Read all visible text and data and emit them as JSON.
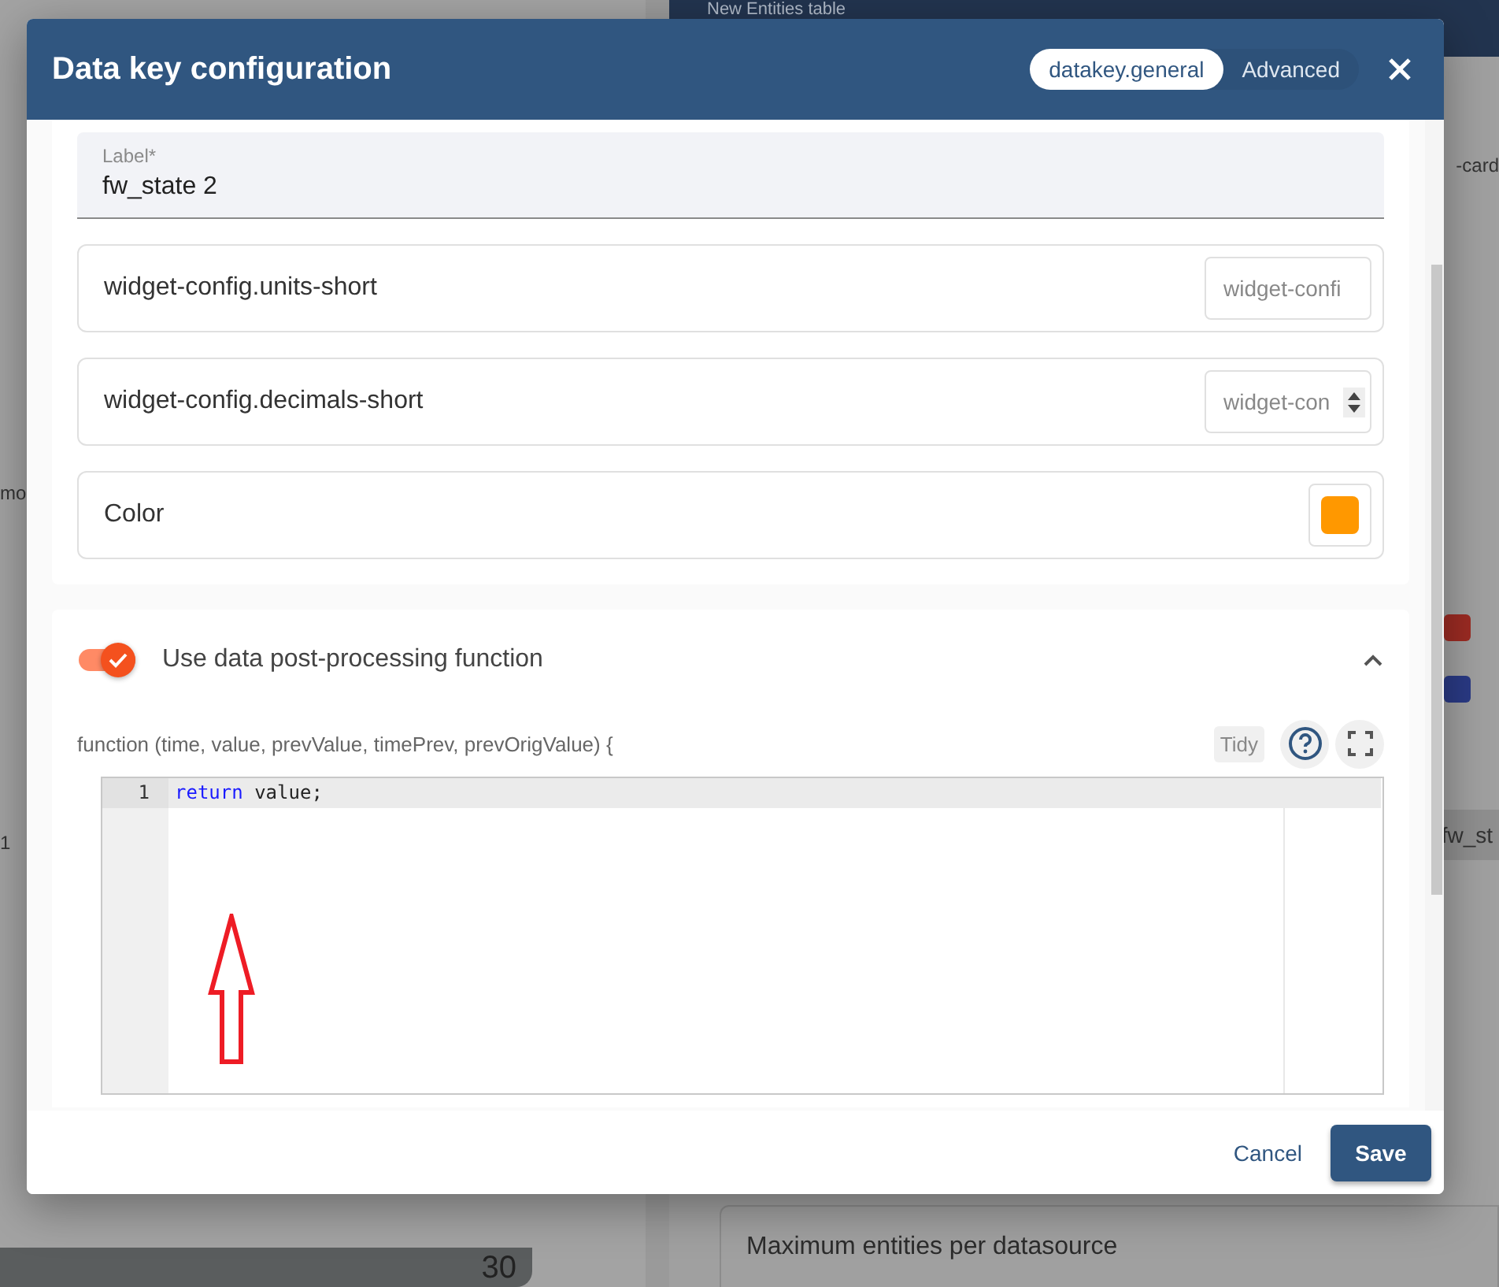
{
  "background": {
    "left_panel": {
      "texts": [
        "mo",
        "1"
      ],
      "count": "30"
    },
    "right_panel": {
      "title": "New Entities table",
      "text_1": "-card",
      "swatches": [
        {
          "color": "#9c2b23"
        },
        {
          "color": "#2a3a85"
        }
      ],
      "key_chip": "fw_st",
      "setting": "Maximum entities per datasource"
    }
  },
  "dialog": {
    "title": "Data key configuration",
    "tabs": [
      {
        "label": "datakey.general",
        "selected": true
      },
      {
        "label": "Advanced",
        "selected": false
      }
    ],
    "label_field": {
      "label": "Label*",
      "value": "fw_state 2"
    },
    "settings": [
      {
        "kind": "text",
        "label": "widget-config.units-short",
        "placeholder": "widget-confi"
      },
      {
        "kind": "number",
        "label": "widget-config.decimals-short",
        "placeholder": "widget-con"
      },
      {
        "kind": "color",
        "label": "Color",
        "color": "#ff9800"
      }
    ],
    "post_processing": {
      "label": "Use data post-processing function",
      "on": true,
      "expanded": true,
      "signature": "function (time, value, prevValue, timePrev, prevOrigValue) {",
      "tidy": "Tidy",
      "code": [
        {
          "number": "1",
          "keyword": "return",
          "rest": " value;"
        }
      ]
    },
    "buttons": {
      "cancel": "Cancel",
      "save": "Save"
    }
  }
}
